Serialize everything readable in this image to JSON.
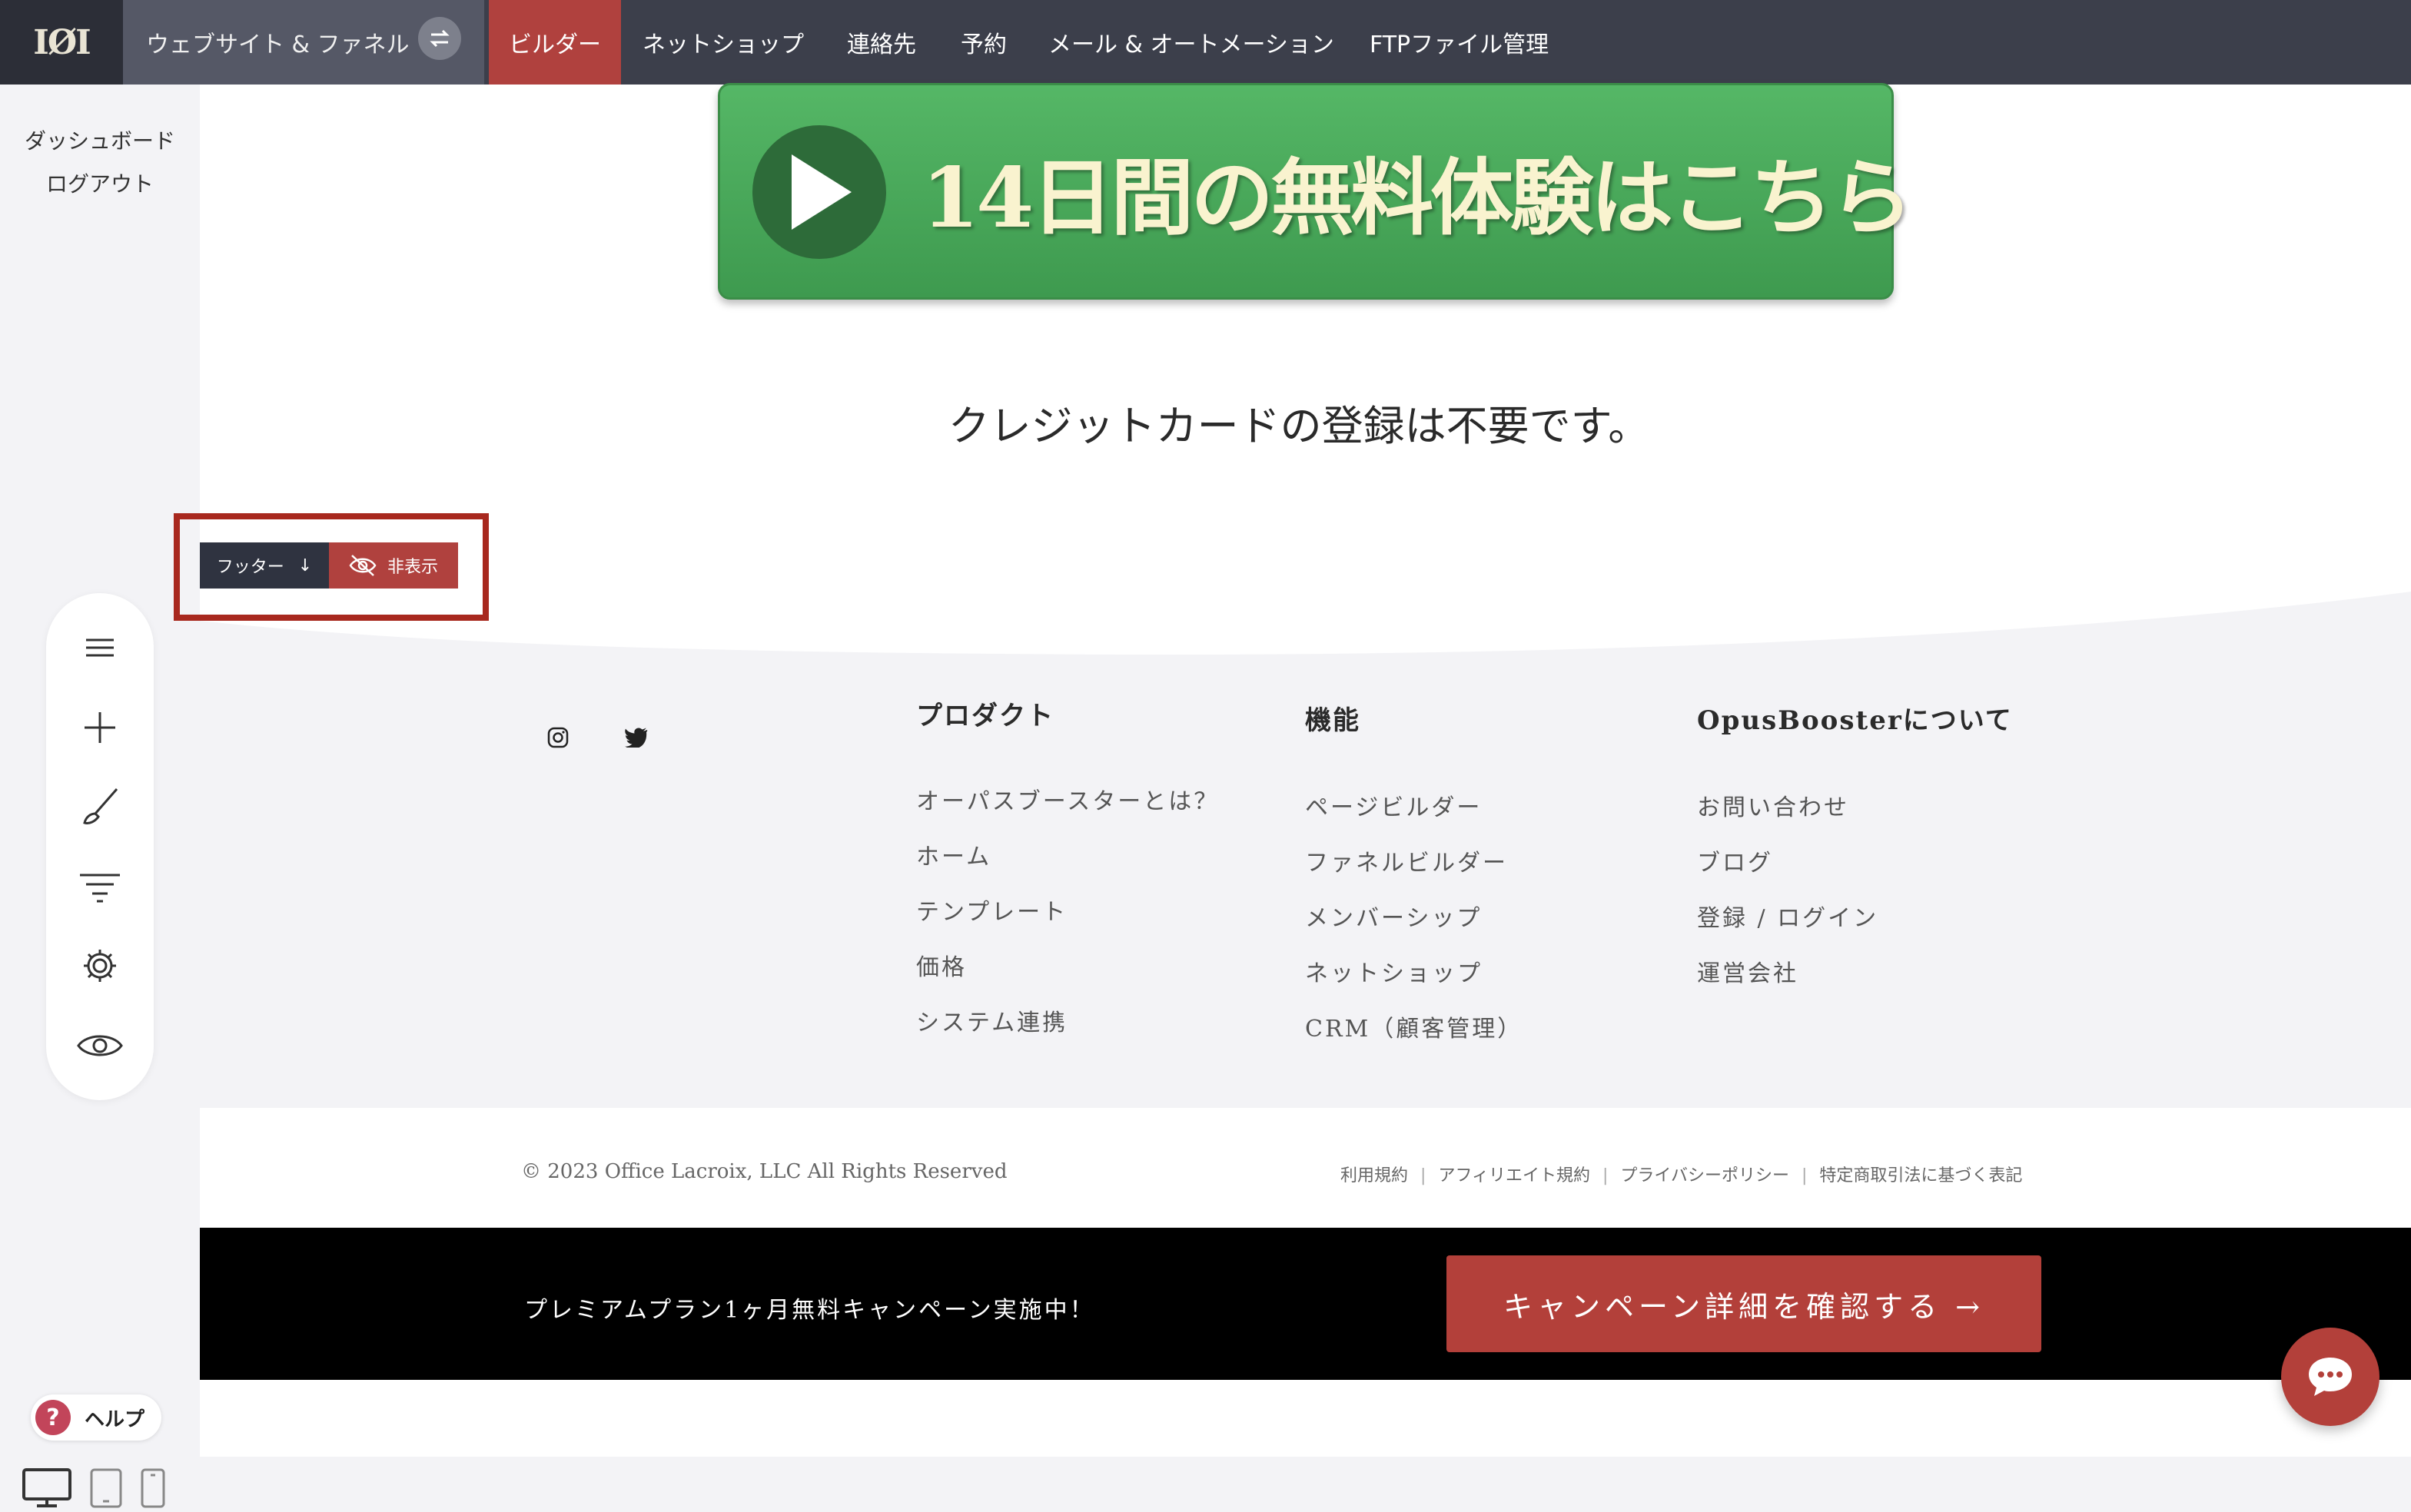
{
  "topnav": {
    "logo_text": "IØI",
    "website_funnel": "ウェブサイト & ファネル",
    "builder": "ビルダー",
    "items": [
      "ネットショップ",
      "連絡先",
      "予約",
      "メール & オートメーション",
      "FTPファイル管理"
    ]
  },
  "sidebar": {
    "dashboard": "ダッシュボード",
    "logout": "ログアウト",
    "tools": [
      "menu-icon",
      "plus-icon",
      "brush-icon",
      "filter-icon",
      "gear-icon",
      "eye-icon"
    ],
    "help": "ヘルプ"
  },
  "canvas": {
    "cta_text": "14日間の無料体験はこちら",
    "no_card": "クレジットカードの登録は不要です。",
    "footer_tab": "フッター",
    "footer_tab_arrow": "↓",
    "hide_label": "非表示"
  },
  "footer": {
    "columns": [
      {
        "heading": "プロダクト",
        "links": [
          "オーパスブースターとは？",
          "ホーム",
          "テンプレート",
          "価格",
          "システム連携"
        ]
      },
      {
        "heading": "機能",
        "links": [
          "ページビルダー",
          "ファネルビルダー",
          "メンバーシップ",
          "ネットショップ",
          "CRM（顧客管理）"
        ]
      },
      {
        "heading": "OpusBoosterについて",
        "links": [
          "お問い合わせ",
          "ブログ",
          "登録 / ログイン",
          "運営会社"
        ]
      }
    ],
    "copyright": "© 2023 Office Lacroix, LLC All Rights Reserved",
    "legal": [
      "利用規約",
      "アフィリエイト規約",
      "プライバシーポリシー",
      "特定商取引法に基づく表記"
    ]
  },
  "promo": {
    "text": "プレミアムプラン1ヶ月無料キャンペーン実施中！",
    "button": "キャンペーン詳細を確認する →"
  },
  "colors": {
    "accent": "#b0413e",
    "nav_bg": "#3c3f4b",
    "cta_green": "#4caf5e"
  }
}
